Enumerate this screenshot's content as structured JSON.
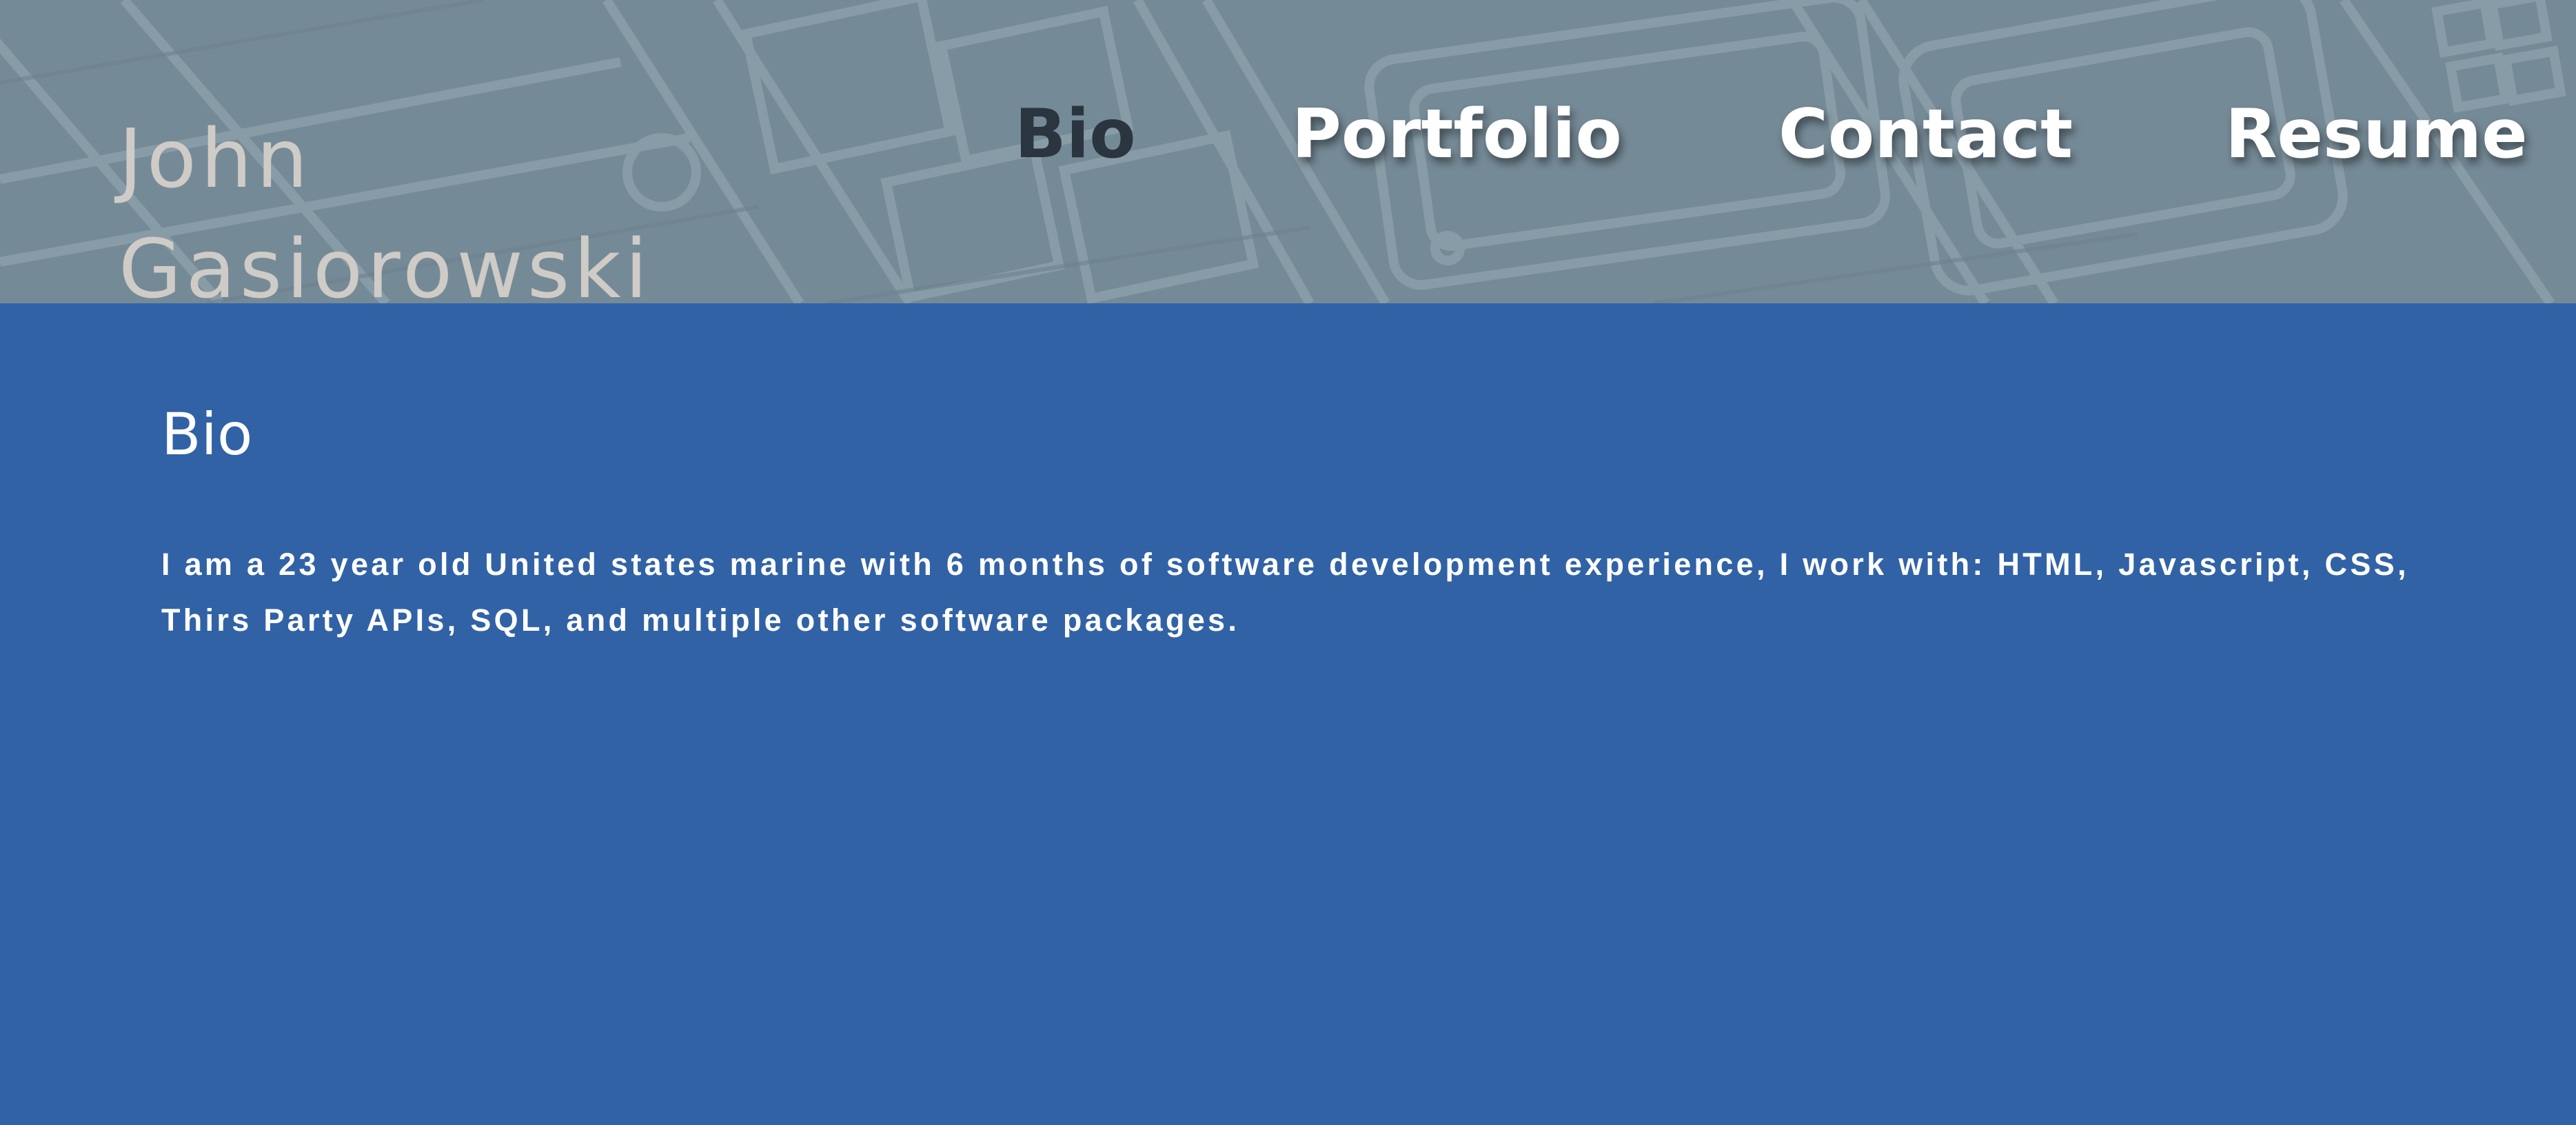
{
  "header": {
    "site_name": "John Gasiorowski"
  },
  "nav": {
    "items": [
      {
        "label": "Bio",
        "active": true
      },
      {
        "label": "Portfolio",
        "active": false
      },
      {
        "label": "Contact",
        "active": false
      },
      {
        "label": "Resume",
        "active": false
      }
    ]
  },
  "main": {
    "section_title": "Bio",
    "bio_text": "I am a 23 year old United states marine with 6 months of software development experience, I work with: HTML, Javascript, CSS, Thirs Party APIs, SQL, and multiple other software packages."
  },
  "colors": {
    "page_background": "#3162a6",
    "header_background": "#758a97",
    "site_name": "#cfcbc6",
    "nav_active": "#2a3540",
    "nav_default": "#ffffff"
  }
}
